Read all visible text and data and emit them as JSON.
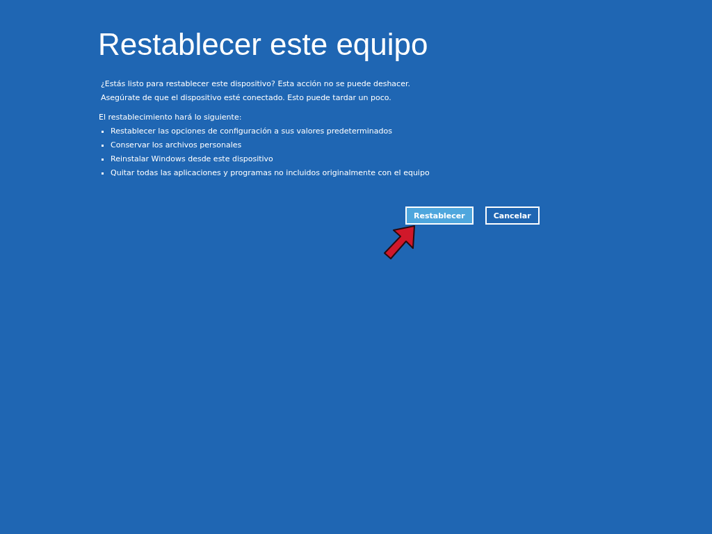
{
  "title": "Restablecer este equipo",
  "intro": [
    "¿Estás listo para restablecer este dispositivo? Esta acción no se puede deshacer.",
    "Asegúrate de que el dispositivo esté conectado. Esto puede tardar un poco."
  ],
  "list_heading": "El restablecimiento hará lo siguiente:",
  "items": [
    "Restablecer las opciones de configuración a sus valores predeterminados",
    "Conservar los archivos personales",
    "Reinstalar Windows desde este dispositivo",
    "Quitar todas las aplicaciones y programas no incluidos originalmente con el equipo"
  ],
  "buttons": [
    {
      "label": "Restablecer",
      "selected": true
    },
    {
      "label": "Cancelar",
      "selected": false
    }
  ]
}
